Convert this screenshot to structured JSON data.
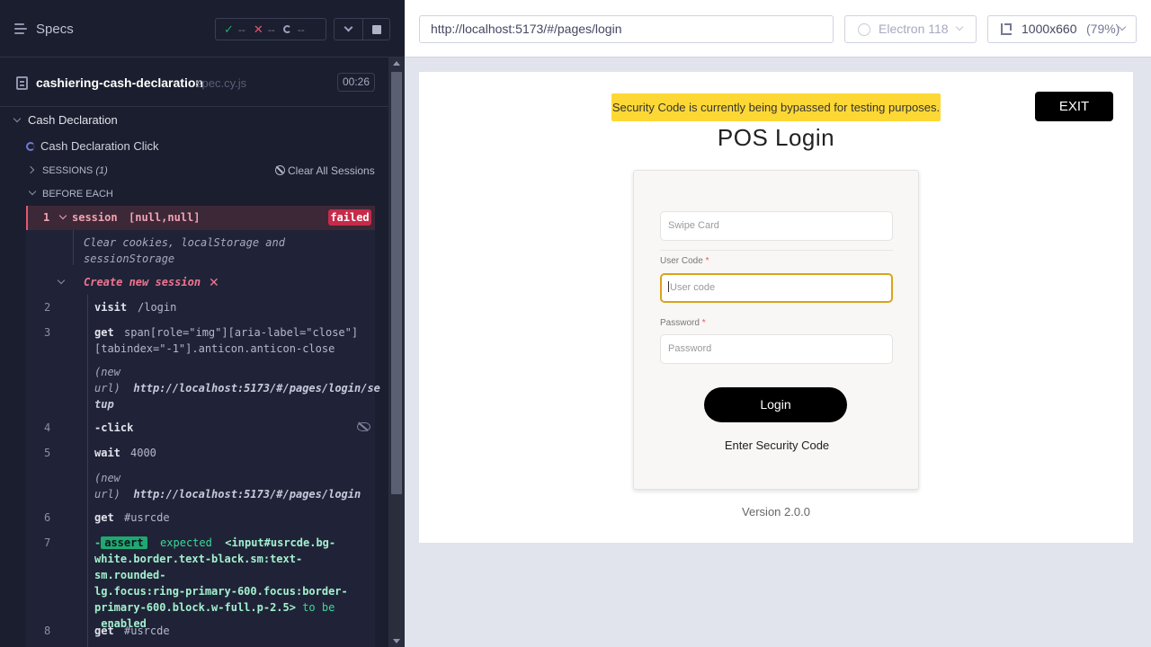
{
  "reporter": {
    "header": {
      "title": "Specs",
      "stats": {
        "passed": "--",
        "failed": "--",
        "pending": "--"
      }
    },
    "spec_file": {
      "name": "cashiering-cash-declaration",
      "ext": "spec.cy.js",
      "duration": "00:26"
    },
    "suite": {
      "title": "Cash Declaration"
    },
    "test": {
      "title": "Cash Declaration Click"
    },
    "sessions": {
      "label": "SESSIONS",
      "count": "(1)",
      "clear_label": "Clear All Sessions"
    },
    "before_each": "BEFORE EACH",
    "failed_cmd": {
      "num": "1",
      "name": "session",
      "args": "[null,null]",
      "status": "failed"
    },
    "clear_comment_1": "Clear cookies, localStorage and",
    "clear_comment_2": "sessionStorage",
    "create_session": "Create new session",
    "create_x": "✕",
    "commands": [
      {
        "num": "2",
        "name": "visit",
        "msg": "/login"
      },
      {
        "num": "3",
        "name": "get",
        "msg_1": "span[role=\"img\"][aria-label=\"close\"]",
        "msg_2": "[tabindex=\"-1\"].anticon.anticon-close"
      },
      {
        "num": "4",
        "name": "-click"
      },
      {
        "num": "5",
        "name": "wait",
        "msg": "4000"
      },
      {
        "num": "6",
        "name": "get",
        "msg": "#usrcde"
      },
      {
        "num": "7",
        "name": "-",
        "badge": "assert"
      },
      {
        "num": "8",
        "name": "get",
        "msg": "#usrcde"
      }
    ],
    "new_url_1": {
      "label_1": "(new",
      "label_2": "url)",
      "url_1": "http://localhost:5173/#/pages/login/se",
      "url_2": "tup"
    },
    "new_url_2": {
      "label_1": "(new",
      "label_2": "url)",
      "url": "http://localhost:5173/#/pages/login"
    },
    "assert_msg": {
      "expected": "expected",
      "el_1": "<input#usrcde.bg-",
      "el_2": "white.border.text-black.sm:text-sm.rounded-",
      "el_3": "lg.focus:ring-primary-600.focus:border-",
      "el_4": "primary-600.block.w-full.p-2.5>",
      "to_be": "to be",
      "enabled": "enabled"
    }
  },
  "browser": {
    "url": "http://localhost:5173/#/pages/login",
    "browser_name": "Electron 118",
    "viewport": "1000x660",
    "zoom": "(79%)"
  },
  "app": {
    "bypass_banner": "Security Code is currently being bypassed for testing purposes.",
    "exit_label": "EXIT",
    "title": "POS Login",
    "swipe_placeholder": "Swipe Card",
    "usercode_label": "User Code",
    "usercode_placeholder": "User code",
    "password_label": "Password",
    "password_placeholder": "Password",
    "required_mark": "*",
    "login_label": "Login",
    "security_link": "Enter Security Code",
    "version": "Version 2.0.0"
  },
  "colors": {
    "reporter_bg": "#1b1e2e",
    "failed": "#c62b49",
    "passed": "#1fa971",
    "banner": "#fdd835",
    "focus_border": "#d9a41a"
  }
}
